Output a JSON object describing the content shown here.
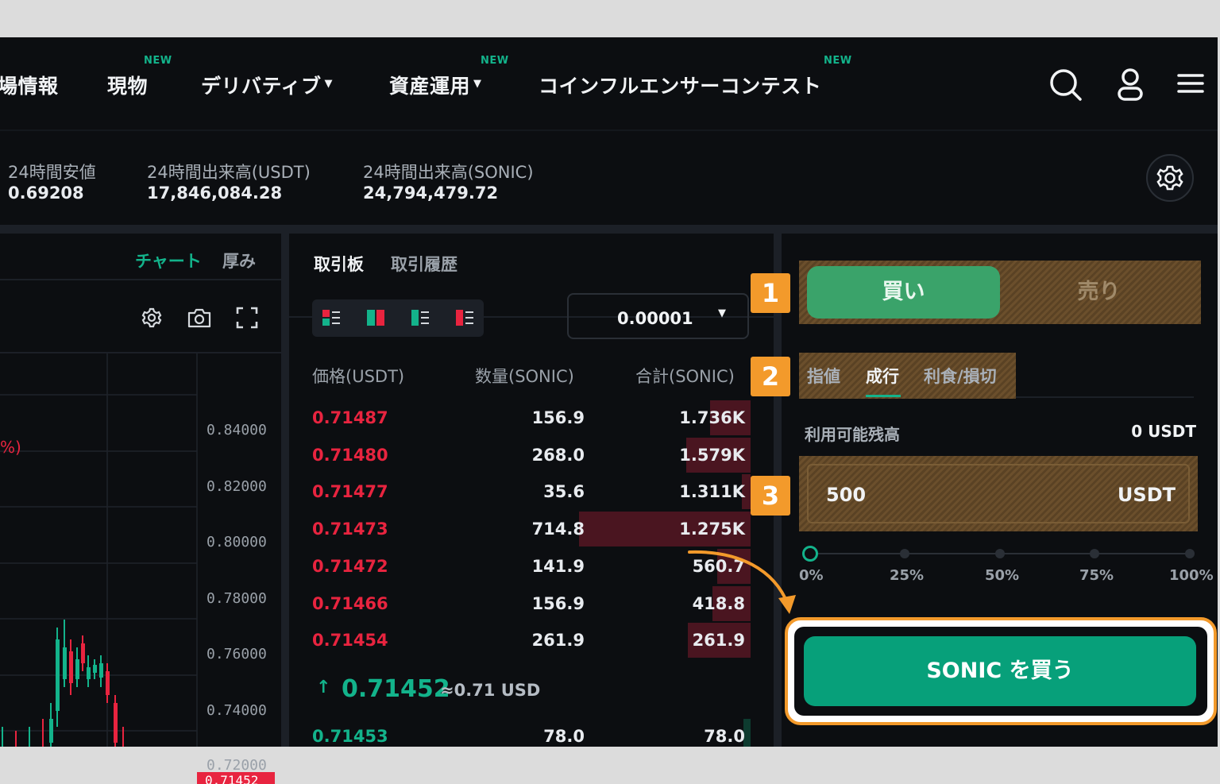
{
  "nav": {
    "items": [
      {
        "label": "場情報",
        "new": false,
        "caret": false
      },
      {
        "label": "現物",
        "new": true,
        "caret": false
      },
      {
        "label": "デリバティブ",
        "new": false,
        "caret": true
      },
      {
        "label": "資産運用",
        "new": true,
        "caret": true
      },
      {
        "label": "コインフルエンサーコンテスト",
        "new": true,
        "caret": false
      }
    ],
    "new_badge": "NEW",
    "icons": [
      "search-icon",
      "user-icon",
      "menu-icon"
    ]
  },
  "stats": [
    {
      "label": "24時間安値",
      "value": "0.69208"
    },
    {
      "label": "24時間出来高(USDT)",
      "value": "17,846,084.28"
    },
    {
      "label": "24時間出来高(SONIC)",
      "value": "24,794,479.72"
    }
  ],
  "chart": {
    "tab_chart": "チャート",
    "tab_depth": "厚み",
    "change_label": "%)",
    "y_ticks": [
      "0.84000",
      "0.82000",
      "0.80000",
      "0.78000",
      "0.76000",
      "0.74000",
      "0.72000"
    ],
    "current_price_tag": "0.71452"
  },
  "orderbook": {
    "tab_book": "取引板",
    "tab_history": "取引履歴",
    "precision": "0.00001",
    "headers": {
      "price": "価格(USDT)",
      "qty": "数量(SONIC)",
      "total": "合計(SONIC)"
    },
    "asks": [
      {
        "price": "0.71487",
        "qty": "156.9",
        "total": "1.736K",
        "depth": 0.18
      },
      {
        "price": "0.71480",
        "qty": "268.0",
        "total": "1.579K",
        "depth": 0.29
      },
      {
        "price": "0.71477",
        "qty": "35.6",
        "total": "1.311K",
        "depth": 0.04
      },
      {
        "price": "0.71473",
        "qty": "714.8",
        "total": "1.275K",
        "depth": 0.77
      },
      {
        "price": "0.71472",
        "qty": "141.9",
        "total": "560.7",
        "depth": 0.15
      },
      {
        "price": "0.71466",
        "qty": "156.9",
        "total": "418.8",
        "depth": 0.17
      },
      {
        "price": "0.71454",
        "qty": "261.9",
        "total": "261.9",
        "depth": 0.28
      }
    ],
    "last_price": "0.71452",
    "last_price_usd": "≈0.71 USD",
    "bids": [
      {
        "price": "0.71453",
        "qty": "78.0",
        "total": "78.0"
      }
    ]
  },
  "order": {
    "buy_label": "買い",
    "sell_label": "売り",
    "order_types": [
      "指値",
      "成行",
      "利食/損切"
    ],
    "active_type": "成行",
    "available_label": "利用可能残高",
    "available_value": "0 USDT",
    "amount_value": "500",
    "amount_unit": "USDT",
    "slider_marks": [
      "0%",
      "25%",
      "50%",
      "75%",
      "100%"
    ],
    "slider_level": 0,
    "submit_label": "SONIC を買う",
    "steps": [
      "1",
      "2",
      "3"
    ]
  },
  "colors": {
    "accent": "#07a07a",
    "ask": "#e8243f",
    "bid": "#13b38b",
    "highlight": "#f39a2b"
  }
}
